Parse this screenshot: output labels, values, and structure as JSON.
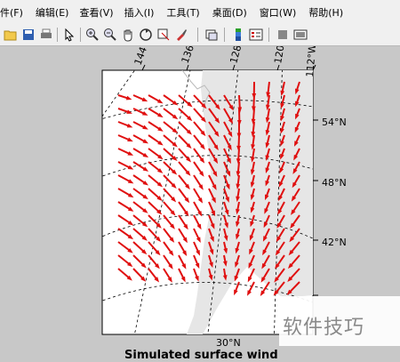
{
  "menu": {
    "file": "件(F)",
    "edit": "编辑(E)",
    "view": "查看(V)",
    "insert": "插入(I)",
    "tools": "工具(T)",
    "desktop": "桌面(D)",
    "window": "窗口(W)",
    "help": "帮助(H)"
  },
  "toolbar": {
    "icons": [
      "open-folder-icon",
      "save-icon",
      "print-icon",
      "pointer-icon",
      "zoom-in-icon",
      "zoom-out-icon",
      "pan-hand-icon",
      "rotate-3d-icon",
      "data-cursor-icon",
      "brush-icon",
      "link-plot-icon",
      "colorbar-icon",
      "legend-icon",
      "hide-plot-tools-icon",
      "show-plot-tools-icon"
    ]
  },
  "map": {
    "lon_labels": [
      "144°",
      "136°",
      "128",
      "120",
      "112°W"
    ],
    "lat_labels": [
      "54°N",
      "48°N",
      "42°N",
      "30°N"
    ],
    "arrow_color": "#e01010"
  },
  "watermark": "软件技巧",
  "caption": "Simulated surface wind"
}
